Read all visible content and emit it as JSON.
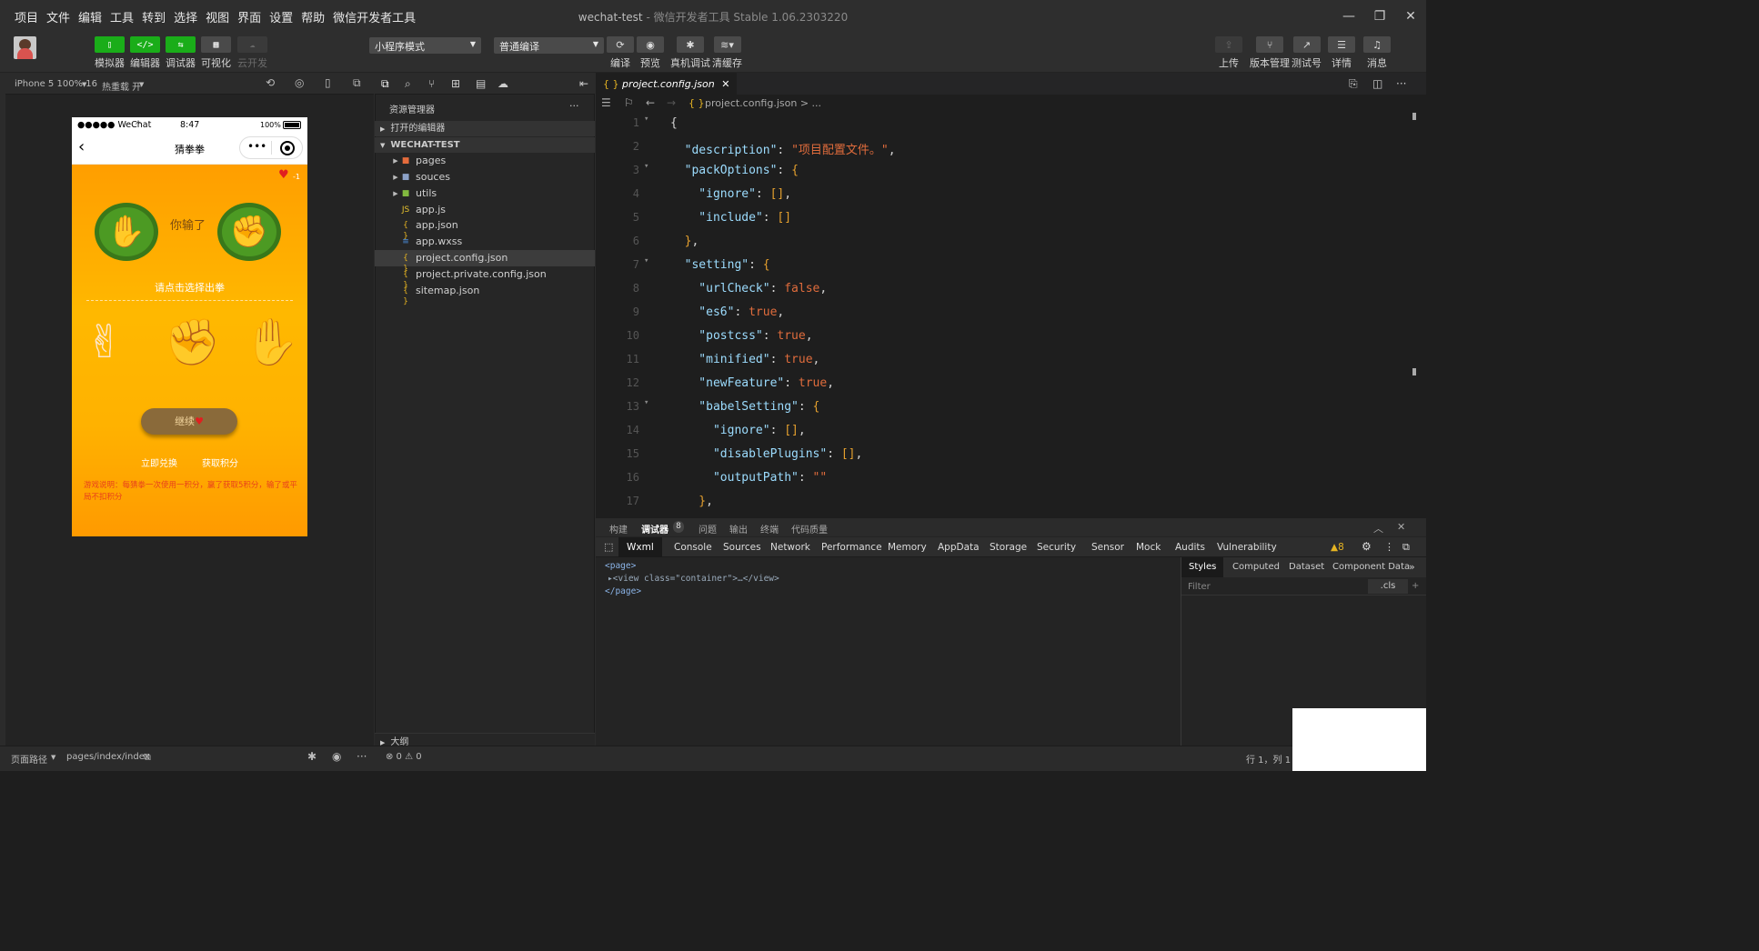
{
  "menu": [
    "项目",
    "文件",
    "编辑",
    "工具",
    "转到",
    "选择",
    "视图",
    "界面",
    "设置",
    "帮助",
    "微信开发者工具"
  ],
  "window": {
    "title": "wechat-test",
    "subtitle": " - 微信开发者工具 Stable 1.06.2303220"
  },
  "toolbar": {
    "simulator": "模拟器",
    "editor": "编辑器",
    "debugger": "调试器",
    "visual": "可视化",
    "cloud": "云开发",
    "mode_select": "小程序模式",
    "compile_select": "普通编译",
    "compile": "编译",
    "preview": "预览",
    "remote_debug": "真机调试",
    "clear_cache": "清缓存",
    "upload": "上传",
    "version": "版本管理",
    "test_account": "测试号",
    "details": "详情",
    "messages": "消息"
  },
  "simbar": {
    "device": "iPhone 5 100% 16",
    "hot_reload": "热重载 开"
  },
  "phone": {
    "carrier": "●●●●● WeChat",
    "time": "8:47",
    "battery": "100%",
    "nav_title": "猜拳拳",
    "lives": "-1",
    "result": "你输了",
    "prompt": "请点击选择出拳",
    "continue": "继续",
    "redeem": "立即兑换",
    "earn": "获取积分",
    "rules": "游戏说明：每猜拳一次使用一积分，赢了获取5积分，输了或平局不扣积分"
  },
  "explorer": {
    "title": "资源管理器",
    "more": "···",
    "open_editors": "打开的编辑器",
    "project": "WECHAT-TEST",
    "items": [
      {
        "name": "pages",
        "type": "folder",
        "color": "#e46b3c"
      },
      {
        "name": "souces",
        "type": "folder",
        "color": "#8ca1c8"
      },
      {
        "name": "utils",
        "type": "folder",
        "color": "#82b93f"
      },
      {
        "name": "app.js",
        "type": "js",
        "color": "#e6c12e"
      },
      {
        "name": "app.json",
        "type": "json",
        "color": "#e6b422"
      },
      {
        "name": "app.wxss",
        "type": "wxss",
        "color": "#4a90e2"
      },
      {
        "name": "project.config.json",
        "type": "json",
        "color": "#e6b422"
      },
      {
        "name": "project.private.config.json",
        "type": "json",
        "color": "#e6b422"
      },
      {
        "name": "sitemap.json",
        "type": "json",
        "color": "#e6b422"
      }
    ],
    "outline": "大纲"
  },
  "editor": {
    "tab": "project.config.json",
    "breadcrumb": "project.config.json > ...",
    "lines": [
      {
        "n": "1",
        "t": [
          [
            "p",
            "{"
          ]
        ]
      },
      {
        "n": "2",
        "t": [
          [
            "k",
            "  \"description\""
          ],
          [
            "p",
            ": "
          ],
          [
            "s",
            "\"项目配置文件。\""
          ],
          [
            "p",
            ","
          ]
        ]
      },
      {
        "n": "3",
        "t": [
          [
            "k",
            "  \"packOptions\""
          ],
          [
            "p",
            ": "
          ],
          [
            "b",
            "{"
          ]
        ]
      },
      {
        "n": "4",
        "t": [
          [
            "k",
            "    \"ignore\""
          ],
          [
            "p",
            ": "
          ],
          [
            "b",
            "[]"
          ],
          [
            "p",
            ","
          ]
        ]
      },
      {
        "n": "5",
        "t": [
          [
            "k",
            "    \"include\""
          ],
          [
            "p",
            ": "
          ],
          [
            "b",
            "[]"
          ]
        ]
      },
      {
        "n": "6",
        "t": [
          [
            "b",
            "  }"
          ],
          [
            "p",
            ","
          ]
        ]
      },
      {
        "n": "7",
        "t": [
          [
            "k",
            "  \"setting\""
          ],
          [
            "p",
            ": "
          ],
          [
            "b",
            "{"
          ]
        ]
      },
      {
        "n": "8",
        "t": [
          [
            "k",
            "    \"urlCheck\""
          ],
          [
            "p",
            ": "
          ],
          [
            "s",
            "false"
          ],
          [
            "p",
            ","
          ]
        ]
      },
      {
        "n": "9",
        "t": [
          [
            "k",
            "    \"es6\""
          ],
          [
            "p",
            ": "
          ],
          [
            "s",
            "true"
          ],
          [
            "p",
            ","
          ]
        ]
      },
      {
        "n": "10",
        "t": [
          [
            "k",
            "    \"postcss\""
          ],
          [
            "p",
            ": "
          ],
          [
            "s",
            "true"
          ],
          [
            "p",
            ","
          ]
        ]
      },
      {
        "n": "11",
        "t": [
          [
            "k",
            "    \"minified\""
          ],
          [
            "p",
            ": "
          ],
          [
            "s",
            "true"
          ],
          [
            "p",
            ","
          ]
        ]
      },
      {
        "n": "12",
        "t": [
          [
            "k",
            "    \"newFeature\""
          ],
          [
            "p",
            ": "
          ],
          [
            "s",
            "true"
          ],
          [
            "p",
            ","
          ]
        ]
      },
      {
        "n": "13",
        "t": [
          [
            "k",
            "    \"babelSetting\""
          ],
          [
            "p",
            ": "
          ],
          [
            "b",
            "{"
          ]
        ]
      },
      {
        "n": "14",
        "t": [
          [
            "k",
            "      \"ignore\""
          ],
          [
            "p",
            ": "
          ],
          [
            "b",
            "[]"
          ],
          [
            "p",
            ","
          ]
        ]
      },
      {
        "n": "15",
        "t": [
          [
            "k",
            "      \"disablePlugins\""
          ],
          [
            "p",
            ": "
          ],
          [
            "b",
            "[]"
          ],
          [
            "p",
            ","
          ]
        ]
      },
      {
        "n": "16",
        "t": [
          [
            "k",
            "      \"outputPath\""
          ],
          [
            "p",
            ": "
          ],
          [
            "s",
            "\"\""
          ]
        ]
      },
      {
        "n": "17",
        "t": [
          [
            "b",
            "    }"
          ],
          [
            "p",
            ","
          ]
        ]
      }
    ]
  },
  "devtools": {
    "top_tabs": [
      "构建",
      "调试器",
      "问题",
      "输出",
      "终端",
      "代码质量"
    ],
    "badge": "8",
    "tabs": [
      "Wxml",
      "Console",
      "Sources",
      "Network",
      "Performance",
      "Memory",
      "AppData",
      "Storage",
      "Security",
      "Sensor",
      "Mock",
      "Audits",
      "Vulnerability"
    ],
    "warn": "▲8",
    "dom": [
      "<page>",
      "▸<view class=\"container\">…</view>",
      "</page>"
    ],
    "style_tabs": [
      "Styles",
      "Computed",
      "Dataset",
      "Component Data"
    ],
    "filter": "Filter",
    "cls": ".cls"
  },
  "status": {
    "path_label": "页面路径",
    "path": "pages/index/index",
    "errors": "⊗ 0 ⚠ 0",
    "cursor": "行 1，列 1"
  }
}
